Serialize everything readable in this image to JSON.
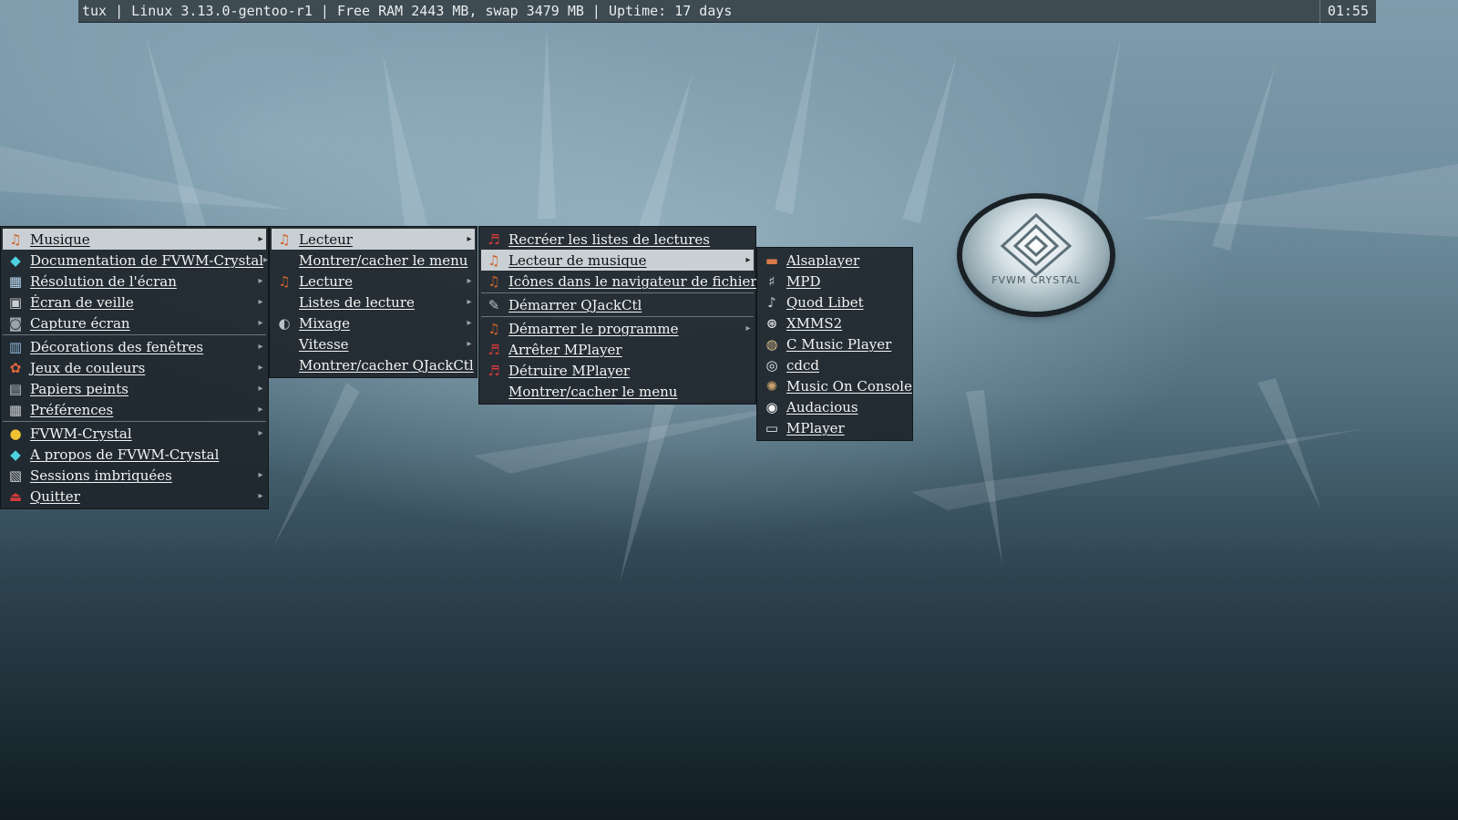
{
  "topbar": {
    "status": "tux | Linux 3.13.0-gentoo-r1 | Free RAM 2443 MB, swap 3479 MB | Uptime: 17 days",
    "clock": "01:55"
  },
  "logo": {
    "text": "FVWM CRYSTAL"
  },
  "menu_main": {
    "items": [
      {
        "label": "Musique",
        "icon": "music-note-icon"
      },
      {
        "label": "Documentation de FVWM-Crystal",
        "icon": "diamond-icon"
      },
      {
        "label": "Résolution de l'écran",
        "icon": "resolution-icon"
      },
      {
        "label": "Écran de veille",
        "icon": "screensaver-icon"
      },
      {
        "label": "Capture écran",
        "icon": "camera-icon"
      },
      {
        "label": "Décorations des fenêtres",
        "icon": "window-decorations-icon"
      },
      {
        "label": "Jeux de couleurs",
        "icon": "color-palette-icon"
      },
      {
        "label": "Papiers peints",
        "icon": "wallpaper-icon"
      },
      {
        "label": "Préférences",
        "icon": "preferences-icon"
      },
      {
        "label": "FVWM-Crystal",
        "icon": "crystal-ball-icon"
      },
      {
        "label": "A propos de FVWM-Crystal",
        "icon": "diamond-icon"
      },
      {
        "label": "Sessions imbriquées",
        "icon": "sessions-icon"
      },
      {
        "label": "Quitter",
        "icon": "exit-icon"
      }
    ]
  },
  "menu_musique": {
    "items": [
      {
        "label": "Lecteur",
        "icon": "music-note-icon"
      },
      {
        "label": "Montrer/cacher le menu",
        "icon": ""
      },
      {
        "label": "Lecture",
        "icon": "music-note-icon"
      },
      {
        "label": "Listes de lecture",
        "icon": ""
      },
      {
        "label": "Mixage",
        "icon": "mixer-icon"
      },
      {
        "label": "Vitesse",
        "icon": ""
      },
      {
        "label": "Montrer/cacher QJackCtl",
        "icon": ""
      }
    ]
  },
  "menu_lecteur": {
    "items": [
      {
        "label": "Recréer les listes de lectures",
        "icon": "playlist-icon"
      },
      {
        "label": "Lecteur de musique",
        "icon": "music-note-icon"
      },
      {
        "label": "Icônes dans le navigateur de fichier",
        "icon": "music-note-icon"
      },
      {
        "label": "Démarrer QJackCtl",
        "icon": "wrench-icon"
      },
      {
        "label": "Démarrer le programme",
        "icon": "music-note-icon"
      },
      {
        "label": "Arrêter MPlayer",
        "icon": "music-notes-icon"
      },
      {
        "label": "Détruire MPlayer",
        "icon": "music-notes-icon"
      },
      {
        "label": "Montrer/cacher le menu",
        "icon": ""
      }
    ]
  },
  "menu_players": {
    "items": [
      {
        "label": "Alsaplayer",
        "icon": "alsaplayer-icon"
      },
      {
        "label": "MPD",
        "icon": "mpd-icon"
      },
      {
        "label": "Quod Libet",
        "icon": "quodlibet-icon"
      },
      {
        "label": "XMMS2",
        "icon": "xmms2-icon"
      },
      {
        "label": "C Music Player",
        "icon": "cmus-icon"
      },
      {
        "label": "cdcd",
        "icon": "cd-icon"
      },
      {
        "label": "Music On Console",
        "icon": "moc-icon"
      },
      {
        "label": "Audacious",
        "icon": "audacious-icon"
      },
      {
        "label": "MPlayer",
        "icon": "mplayer-icon"
      }
    ]
  },
  "colors": {
    "menu_bg": "#1e262b",
    "menu_active_bg": "#c9cfd2",
    "topbar_bg": "#3e4b52"
  }
}
